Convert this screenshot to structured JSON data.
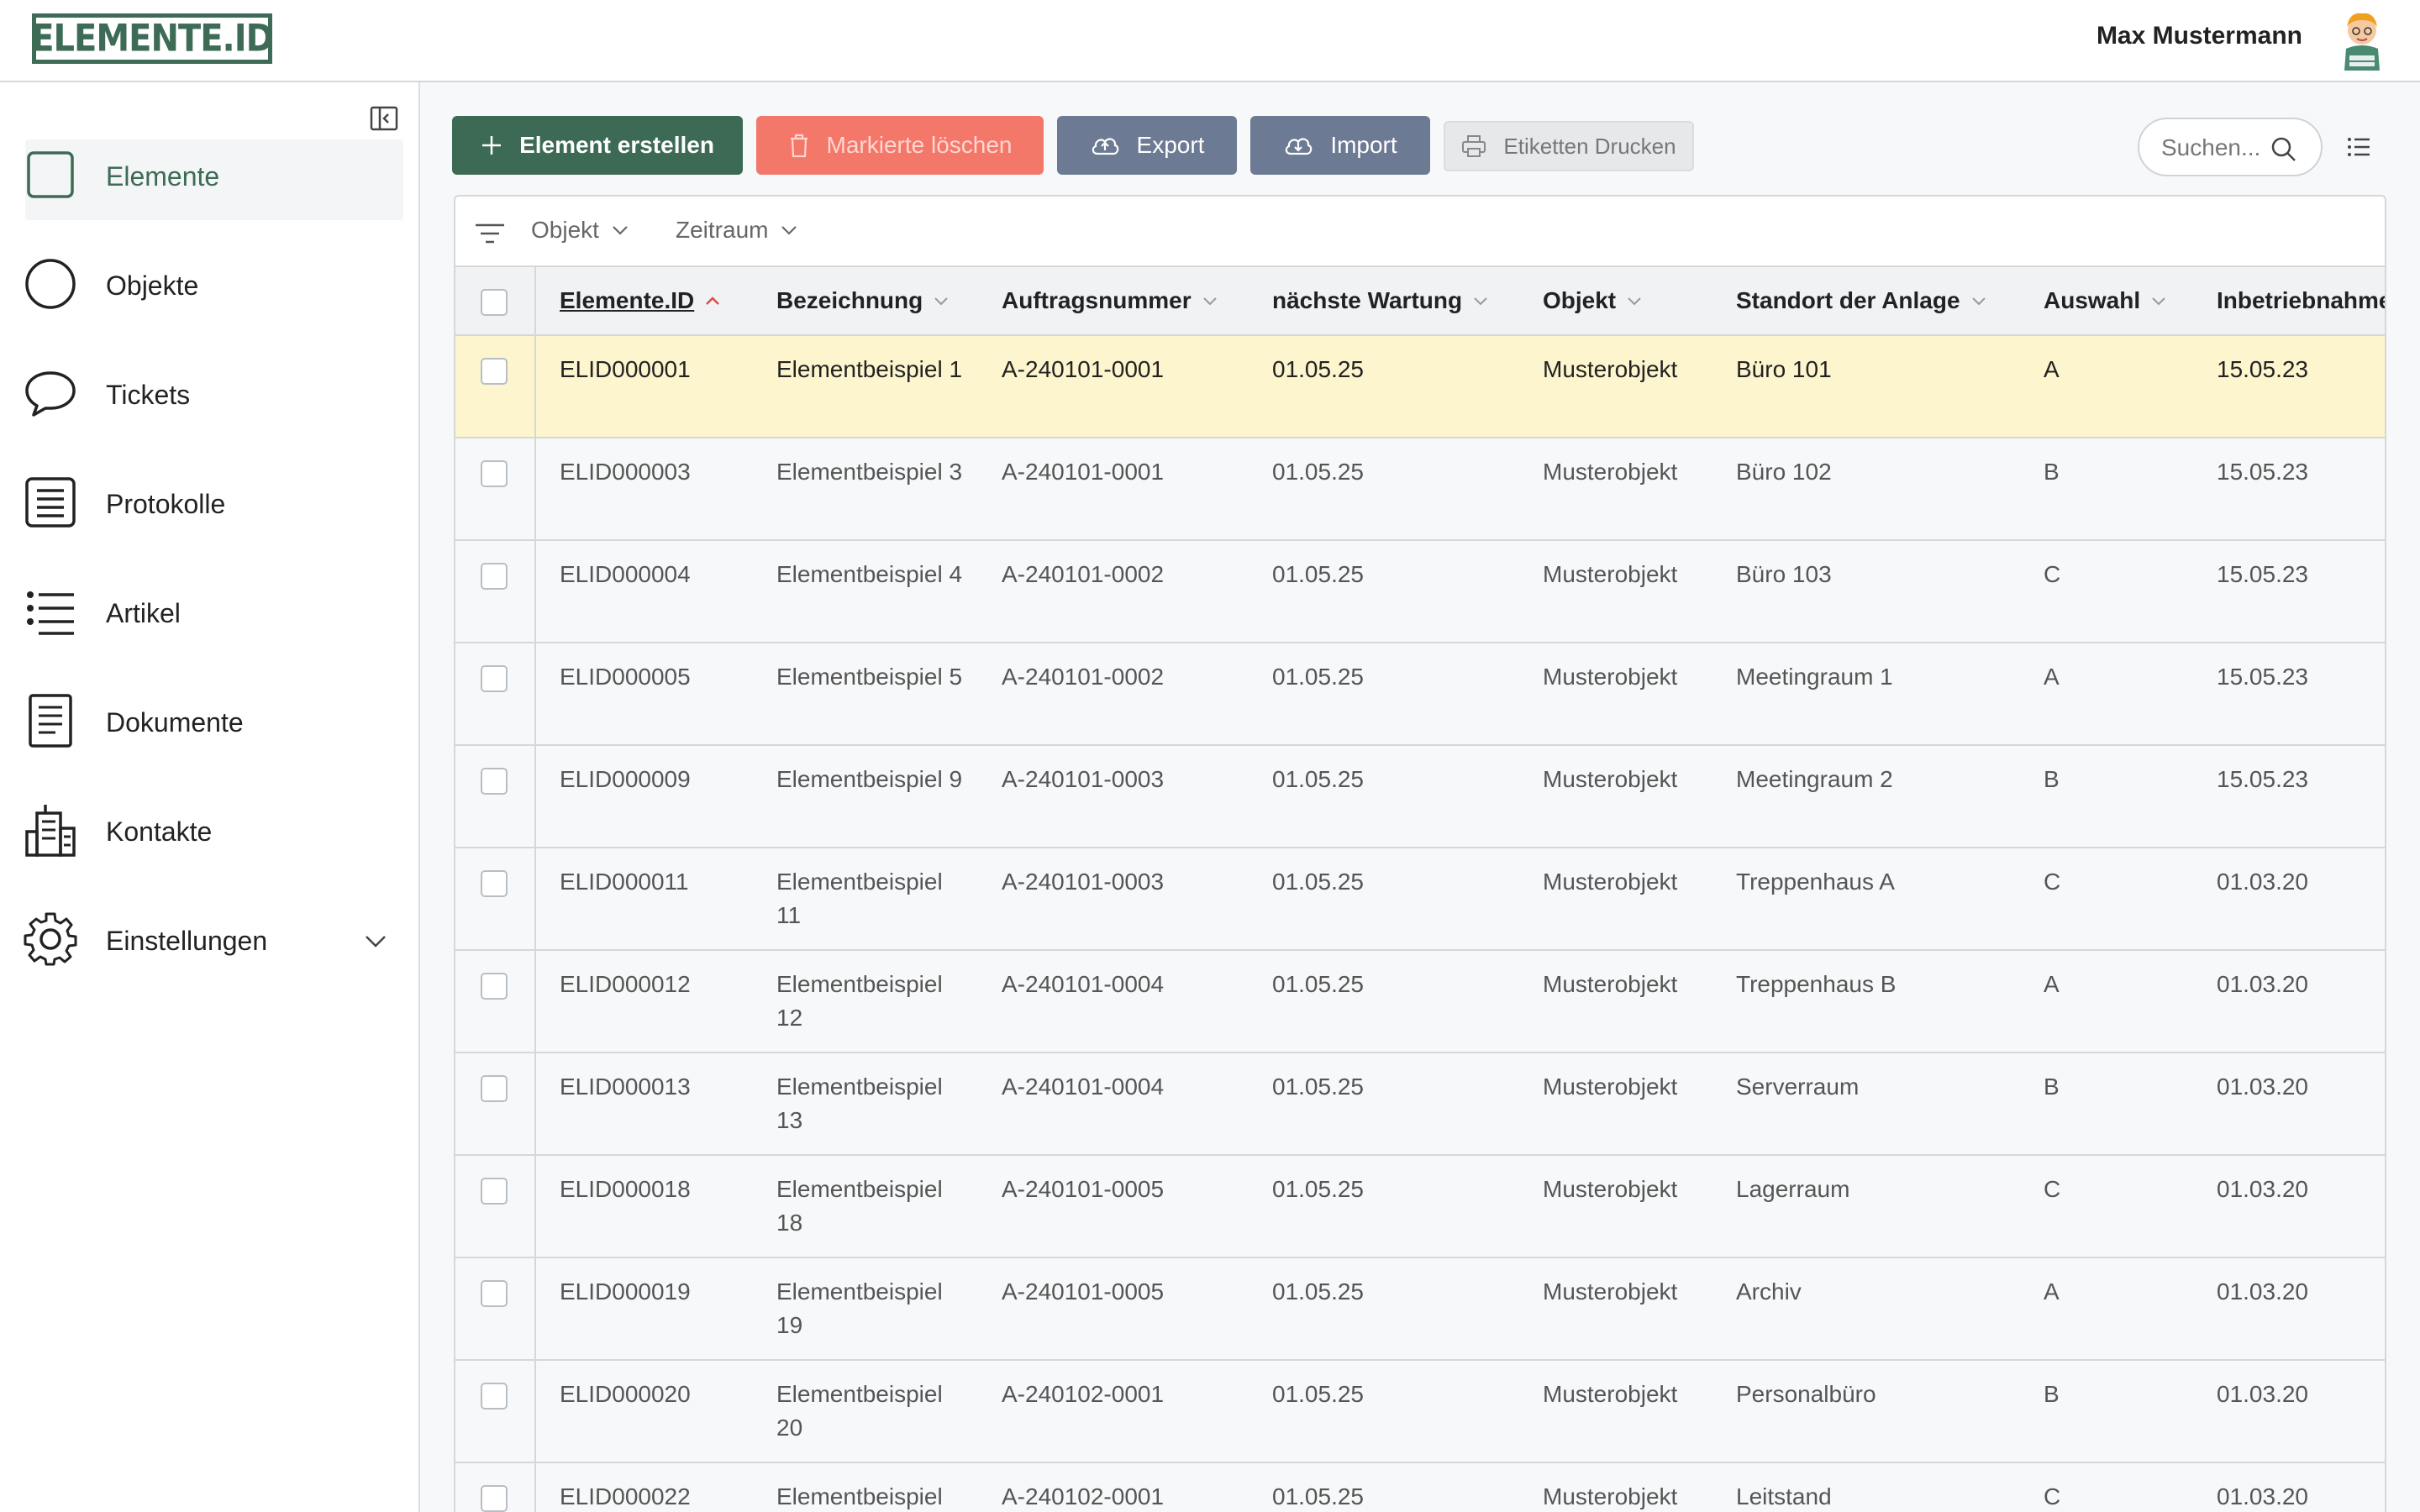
{
  "header": {
    "logo_text": "ELEMENTE.ID",
    "user_name": "Max Mustermann"
  },
  "sidebar": {
    "items": [
      {
        "label": "Elemente",
        "icon": "square-icon",
        "active": true
      },
      {
        "label": "Objekte",
        "icon": "circle-icon"
      },
      {
        "label": "Tickets",
        "icon": "speech-bubble-icon"
      },
      {
        "label": "Protokolle",
        "icon": "protocol-icon"
      },
      {
        "label": "Artikel",
        "icon": "list-icon"
      },
      {
        "label": "Dokumente",
        "icon": "document-icon"
      },
      {
        "label": "Kontakte",
        "icon": "buildings-icon"
      },
      {
        "label": "Einstellungen",
        "icon": "gear-icon"
      }
    ]
  },
  "toolbar": {
    "create_label": "Element erstellen",
    "delete_label": "Markierte löschen",
    "export_label": "Export",
    "import_label": "Import",
    "print_label": "Etiketten Drucken",
    "search_placeholder": "Suchen..."
  },
  "filters": {
    "objekt_label": "Objekt",
    "zeitraum_label": "Zeitraum"
  },
  "table": {
    "columns": [
      "Elemente.ID",
      "Bezeichnung",
      "Auftragsnummer",
      "nächste Wartung",
      "Objekt",
      "Standort der Anlage",
      "Auswahl",
      "Inbetriebnahme"
    ],
    "rows": [
      {
        "id": "ELID000001",
        "bez": "Elementbeispiel 1",
        "auf": "A-240101-0001",
        "wart": "01.05.25",
        "obj": "Musterobjekt",
        "std": "Büro 101",
        "aus": "A",
        "inb": "15.05.23"
      },
      {
        "id": "ELID000003",
        "bez": "Elementbeispiel 3",
        "auf": "A-240101-0001",
        "wart": "01.05.25",
        "obj": "Musterobjekt",
        "std": "Büro 102",
        "aus": "B",
        "inb": "15.05.23"
      },
      {
        "id": "ELID000004",
        "bez": "Elementbeispiel 4",
        "auf": "A-240101-0002",
        "wart": "01.05.25",
        "obj": "Musterobjekt",
        "std": "Büro 103",
        "aus": "C",
        "inb": "15.05.23"
      },
      {
        "id": "ELID000005",
        "bez": "Elementbeispiel 5",
        "auf": "A-240101-0002",
        "wart": "01.05.25",
        "obj": "Musterobjekt",
        "std": "Meetingraum 1",
        "aus": "A",
        "inb": "15.05.23"
      },
      {
        "id": "ELID000009",
        "bez": "Elementbeispiel 9",
        "auf": "A-240101-0003",
        "wart": "01.05.25",
        "obj": "Musterobjekt",
        "std": "Meetingraum 2",
        "aus": "B",
        "inb": "15.05.23"
      },
      {
        "id": "ELID000011",
        "bez": "Elementbeispiel 11",
        "auf": "A-240101-0003",
        "wart": "01.05.25",
        "obj": "Musterobjekt",
        "std": "Treppenhaus A",
        "aus": "C",
        "inb": "01.03.20"
      },
      {
        "id": "ELID000012",
        "bez": "Elementbeispiel 12",
        "auf": "A-240101-0004",
        "wart": "01.05.25",
        "obj": "Musterobjekt",
        "std": "Treppenhaus B",
        "aus": "A",
        "inb": "01.03.20"
      },
      {
        "id": "ELID000013",
        "bez": "Elementbeispiel 13",
        "auf": "A-240101-0004",
        "wart": "01.05.25",
        "obj": "Musterobjekt",
        "std": "Serverraum",
        "aus": "B",
        "inb": "01.03.20"
      },
      {
        "id": "ELID000018",
        "bez": "Elementbeispiel 18",
        "auf": "A-240101-0005",
        "wart": "01.05.25",
        "obj": "Musterobjekt",
        "std": "Lagerraum",
        "aus": "C",
        "inb": "01.03.20"
      },
      {
        "id": "ELID000019",
        "bez": "Elementbeispiel 19",
        "auf": "A-240101-0005",
        "wart": "01.05.25",
        "obj": "Musterobjekt",
        "std": "Archiv",
        "aus": "A",
        "inb": "01.03.20"
      },
      {
        "id": "ELID000020",
        "bez": "Elementbeispiel 20",
        "auf": "A-240102-0001",
        "wart": "01.05.25",
        "obj": "Musterobjekt",
        "std": "Personalbüro",
        "aus": "B",
        "inb": "01.03.20"
      },
      {
        "id": "ELID000022",
        "bez": "Elementbeispiel",
        "auf": "A-240102-0001",
        "wart": "01.05.25",
        "obj": "Musterobjekt",
        "std": "Leitstand",
        "aus": "C",
        "inb": "01.03.20"
      }
    ]
  },
  "colors": {
    "brand": "#3d6b56",
    "danger": "#f4786a",
    "secondary": "#6c7a93",
    "highlight_row": "#fdf5cd"
  }
}
